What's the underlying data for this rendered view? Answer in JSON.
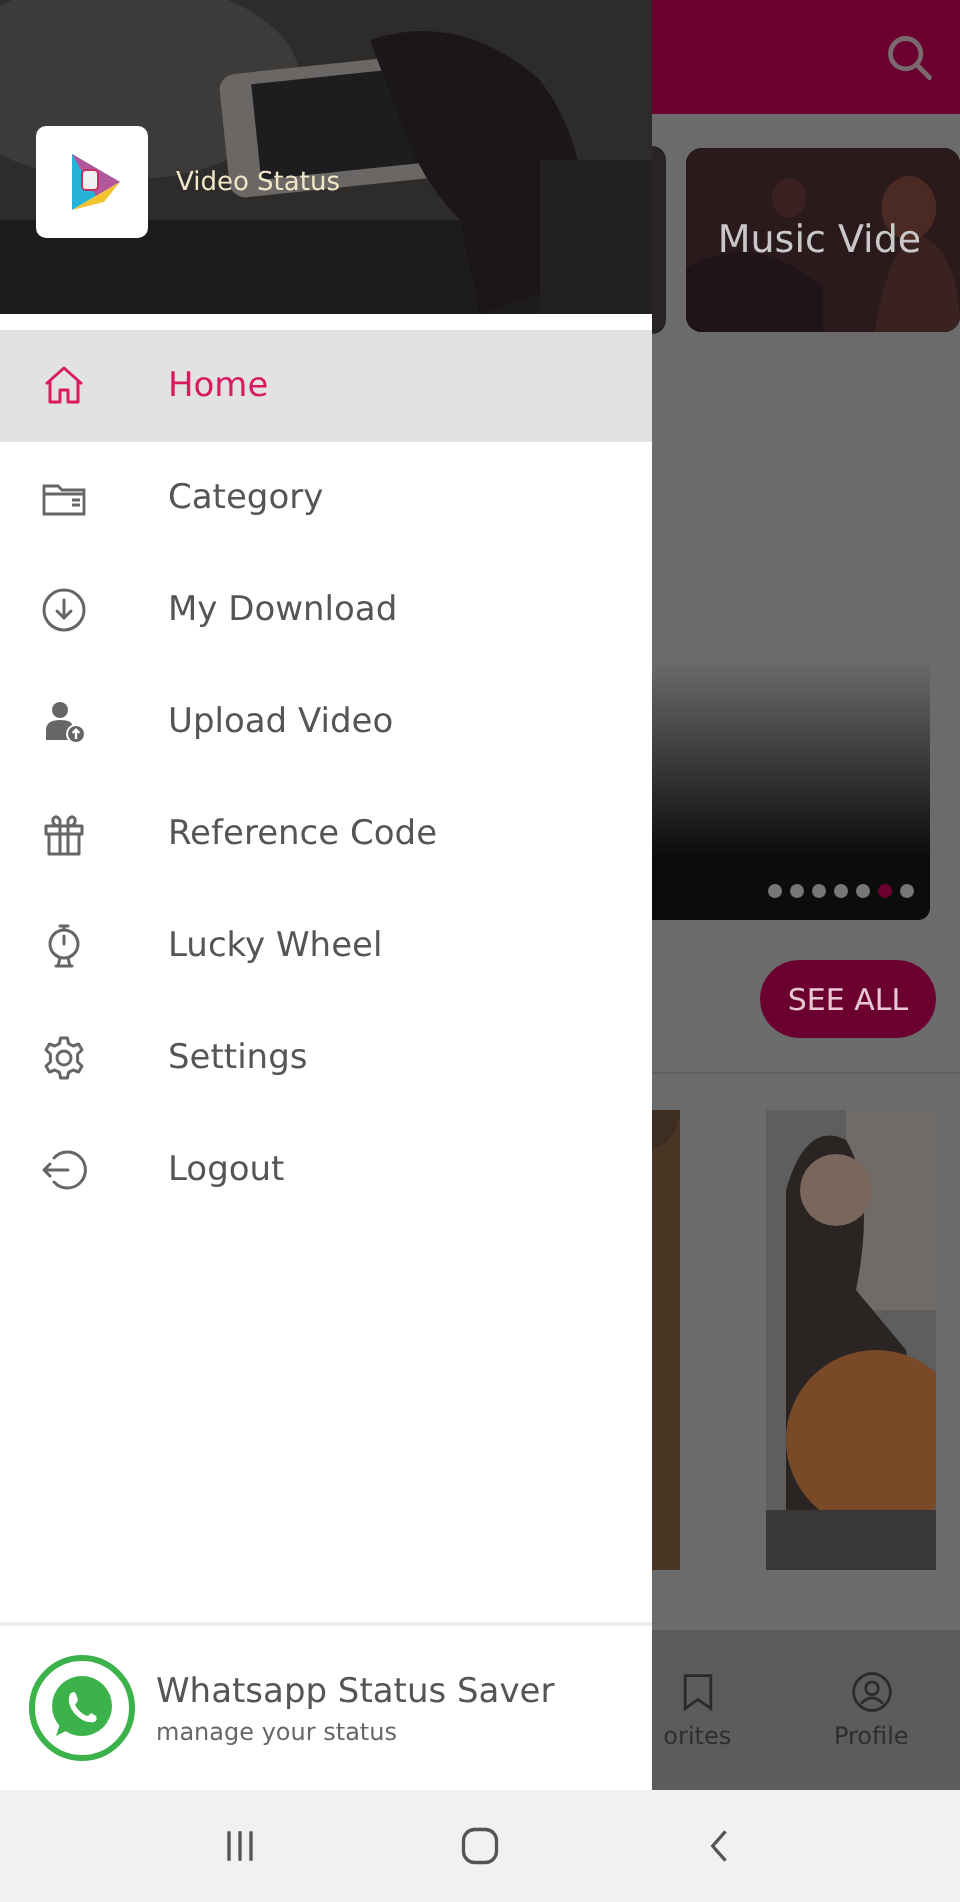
{
  "drawer": {
    "header": {
      "kind": "picture",
      "app_name": "Video Status"
    },
    "menu": [
      {
        "label": "Home",
        "selected": true
      },
      {
        "label": "Category",
        "selected": false
      },
      {
        "label": "My Download",
        "selected": false
      },
      {
        "label": "Upload Video",
        "selected": false
      },
      {
        "label": "Reference Code",
        "selected": false
      },
      {
        "label": "Lucky Wheel",
        "selected": false
      },
      {
        "label": "Settings",
        "selected": false
      },
      {
        "label": "Logout",
        "selected": false
      }
    ],
    "promo": {
      "title": "Whatsapp Status Saver",
      "subtitle": "manage your status"
    }
  },
  "background": {
    "featured_card": {
      "title": "Music Vide"
    },
    "carousel_dots": [
      {
        "selected": false
      },
      {
        "selected": false
      },
      {
        "selected": false
      },
      {
        "selected": false
      },
      {
        "selected": false
      },
      {
        "selected": true
      },
      {
        "selected": false
      }
    ],
    "see_all": "SEE ALL",
    "bottom_nav": [
      {
        "label": "orites"
      },
      {
        "label": "Profile"
      }
    ]
  }
}
